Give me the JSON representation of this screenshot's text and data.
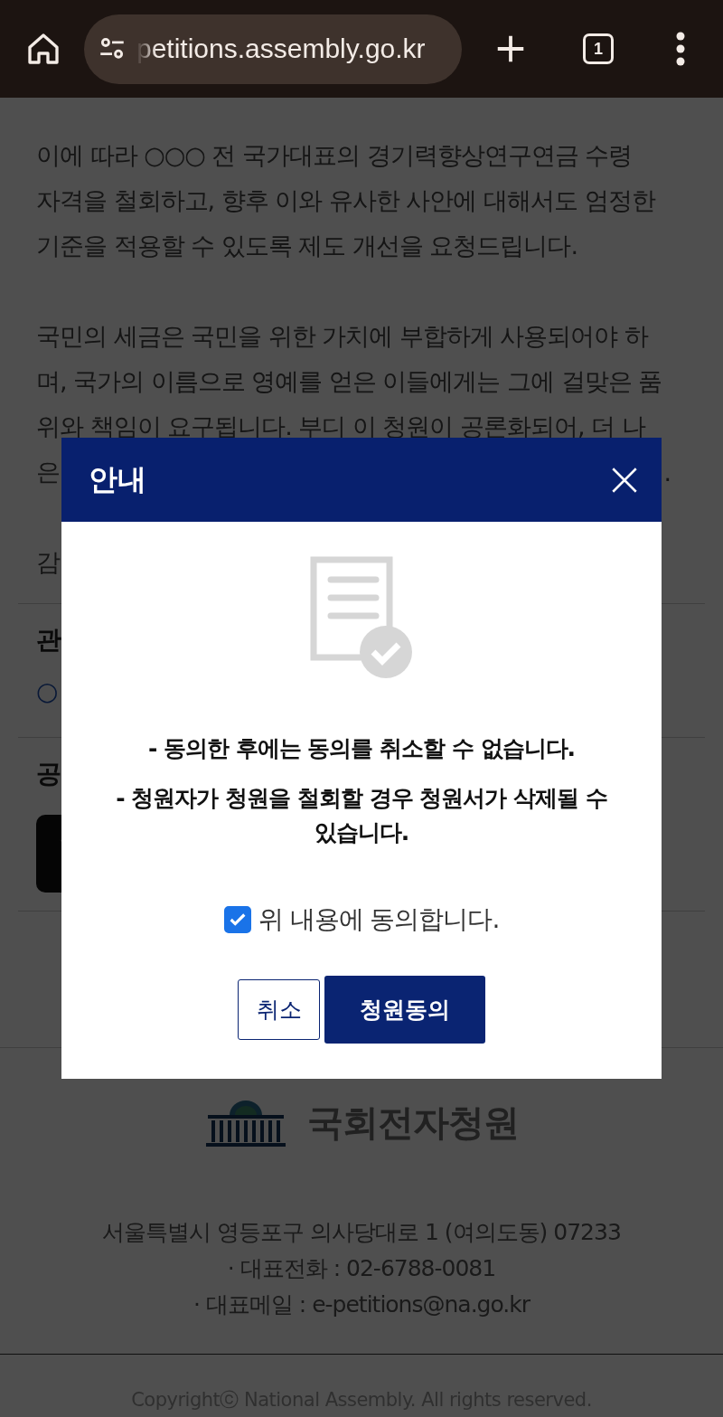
{
  "browser": {
    "url": "petitions.assembly.go.kr",
    "tab_count": "1"
  },
  "article": {
    "paragraphs": [
      {
        "lines": [
          {
            "text": "이에 따라 ○○○ 전 국가대표의 경기력향상연구연금 수령"
          },
          {
            "text": "자격을 철회하고, 향후 이와 유사한 사안에 대해서도 엄정한"
          },
          {
            "text": "기준을 적용할 수 있도록 제도 개선을 요청드립니다."
          }
        ]
      },
      {
        "lines": [
          {
            "text": "국민의 세금은 국민을 위한 가치에 부합하게 사용되어야 하"
          },
          {
            "text": "며, 국가의 이름으로 영예를 얻은 이들에게는 그에 걸맞은 품"
          },
          {
            "text": "위와 책임이 요구됩니다. 부디 이 청원이 공론화되어, 더 나"
          },
          {
            "text": "은",
            "tail": "."
          }
        ]
      },
      {
        "lines": [
          {
            "text": "감"
          }
        ]
      }
    ]
  },
  "sections": [
    {
      "kind": "divider"
    },
    {
      "kind": "heading",
      "text": "관"
    },
    {
      "kind": "link",
      "text": "○"
    },
    {
      "kind": "divider"
    },
    {
      "kind": "heading",
      "text": "공"
    },
    {
      "kind": "share"
    },
    {
      "kind": "divider"
    }
  ],
  "footer": {
    "logo_text": "국회전자청원",
    "address": "서울특별시 영등포구 의사당대로 1 (여의도동) 07233",
    "contacts": [
      "· 대표전화 : 02-6788-0081",
      "· 대표메일 : e-petitions@na.go.kr"
    ],
    "copyright": "Copyrightⓒ National Assembly. All rights reserved."
  },
  "modal": {
    "title": "안내",
    "notices": [
      "- 동의한 후에는 동의를 취소할 수 없습니다.",
      "- 청원자가 청원을 철회할 경우 청원서가 삭제될 수 있습니다."
    ],
    "agree": {
      "label": "위 내용에 동의합니다.",
      "checked": true
    },
    "buttons": [
      {
        "label": "취소",
        "kind": "secondary"
      },
      {
        "label": "청원동의",
        "kind": "primary"
      }
    ]
  }
}
